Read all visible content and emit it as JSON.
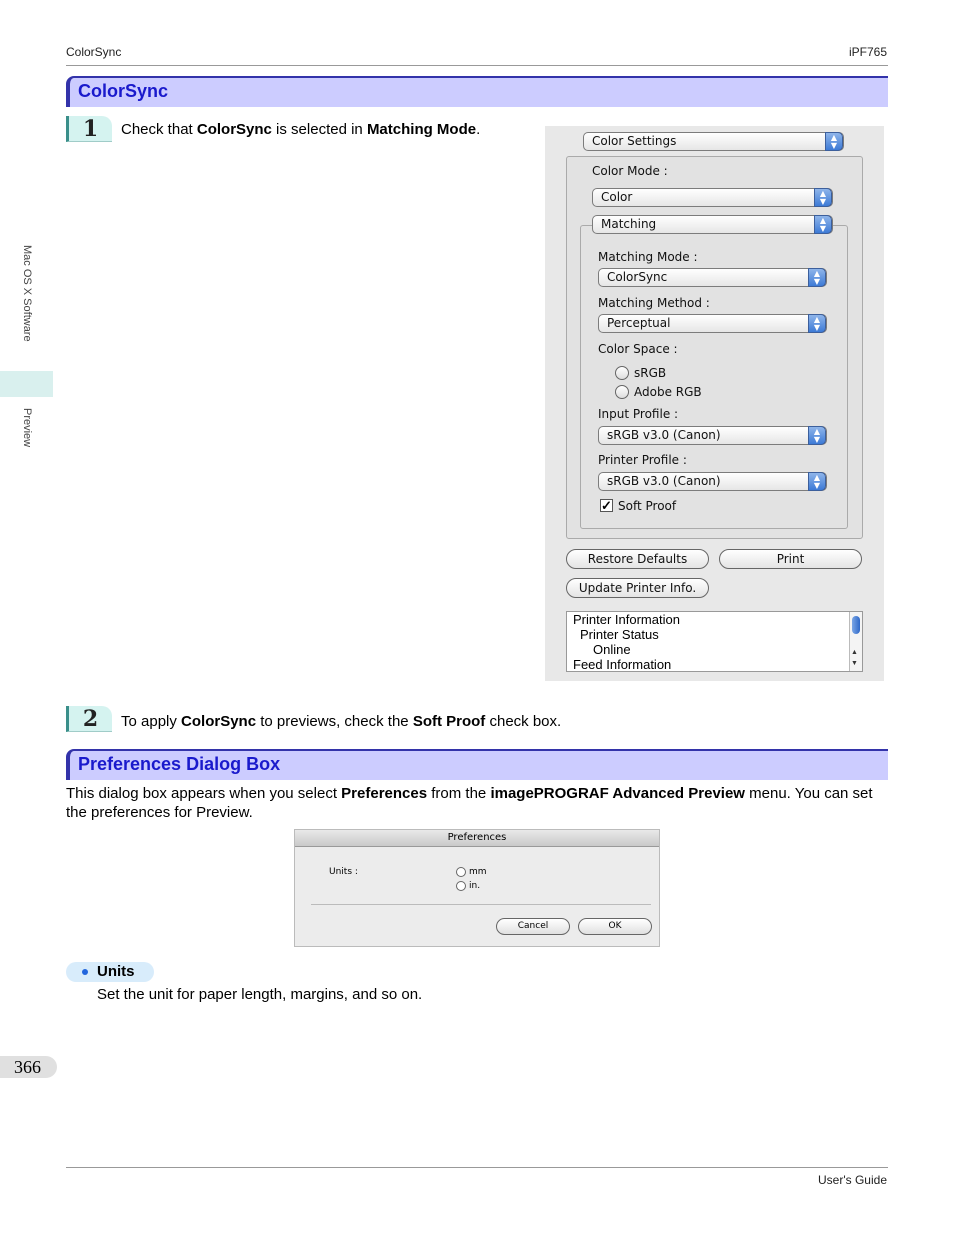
{
  "header": {
    "left": "ColorSync",
    "right": "iPF765"
  },
  "side_tab": {
    "chapter": "Mac OS X Software",
    "section": "Preview"
  },
  "section1": {
    "title": "ColorSync",
    "step1": {
      "num": "1",
      "t1": "Check that ",
      "b1": "ColorSync",
      "t2": " is selected in ",
      "b2": "Matching Mode",
      "t3": "."
    },
    "step2": {
      "num": "2",
      "t1": "To apply ",
      "b1": "ColorSync",
      "t2": " to previews, check the ",
      "b2": "Soft Proof",
      "t3": " check box."
    }
  },
  "colorsync_panel": {
    "top_popup": "Color Settings",
    "color_mode_label": "Color Mode :",
    "color_mode_value": "Color",
    "matching_tab": "Matching",
    "matching_mode_label": "Matching Mode :",
    "matching_mode_value": "ColorSync",
    "matching_method_label": "Matching Method :",
    "matching_method_value": "Perceptual",
    "color_space_label": "Color Space :",
    "color_space_options": [
      "sRGB",
      "Adobe RGB"
    ],
    "input_profile_label": "Input Profile :",
    "input_profile_value": "sRGB v3.0 (Canon)",
    "printer_profile_label": "Printer Profile :",
    "printer_profile_value": "sRGB v3.0 (Canon)",
    "soft_proof_label": "Soft Proof",
    "soft_proof_checked": true,
    "restore_defaults_label": "Restore Defaults",
    "print_label": "Print",
    "update_printer_label": "Update Printer Info.",
    "info_list": [
      "Printer Information",
      "Printer Status",
      "Online",
      "Feed Information"
    ]
  },
  "section2": {
    "title": "Preferences Dialog Box",
    "p_t1": "This dialog box appears when you select ",
    "p_b1": "Preferences",
    "p_t2": " from the ",
    "p_b2": "imagePROGRAF Advanced Preview",
    "p_t3": " menu. You can set the preferences for Preview."
  },
  "pref_dialog": {
    "title": "Preferences",
    "units_label": "Units :",
    "options": [
      "mm",
      "in."
    ],
    "cancel": "Cancel",
    "ok": "OK"
  },
  "units_item": {
    "label": "Units",
    "desc": "Set the unit for paper length, margins, and so on."
  },
  "page_number": "366",
  "footer": {
    "right": "User's Guide"
  }
}
